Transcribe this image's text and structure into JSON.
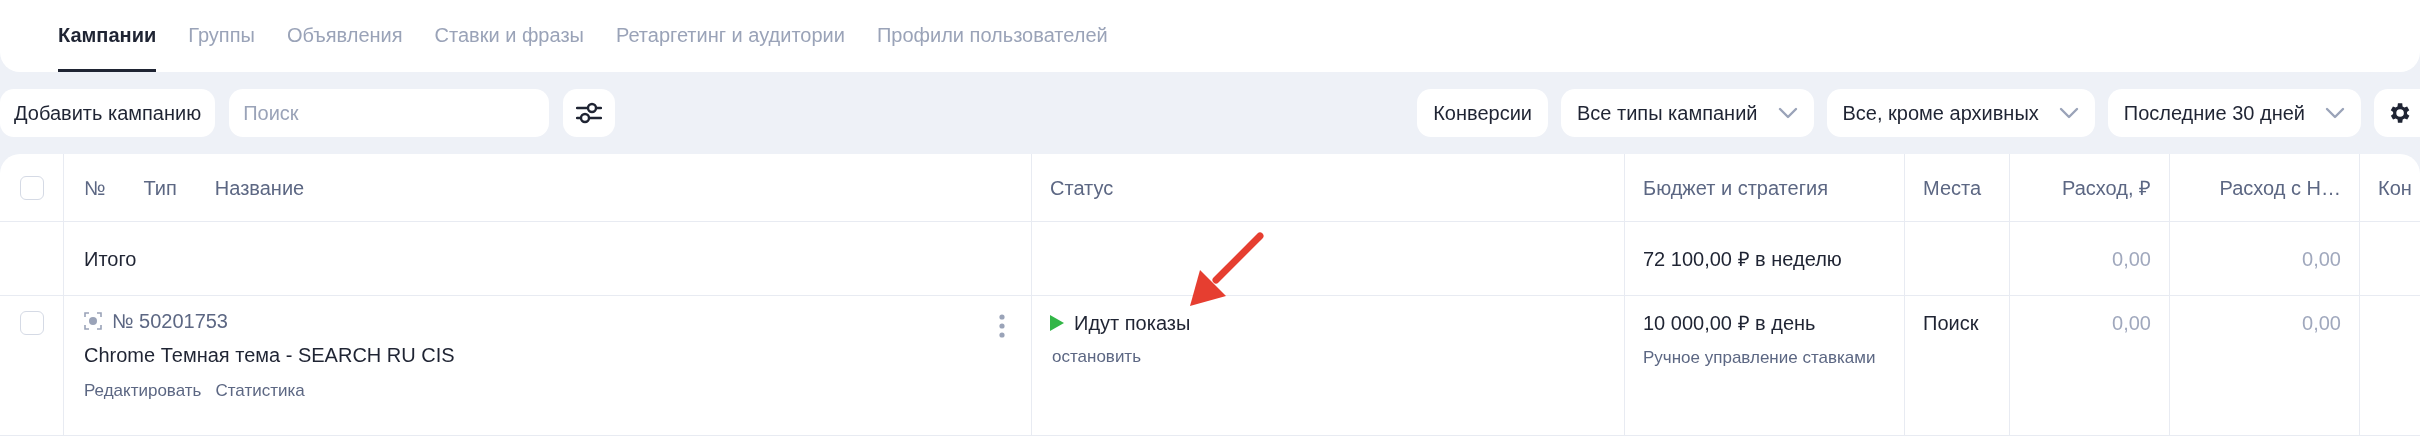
{
  "tabs": [
    {
      "label": "Кампании",
      "selected": true
    },
    {
      "label": "Группы",
      "selected": false
    },
    {
      "label": "Объявления",
      "selected": false
    },
    {
      "label": "Ставки и фразы",
      "selected": false
    },
    {
      "label": "Ретаргетинг и аудитории",
      "selected": false
    },
    {
      "label": "Профили пользователей",
      "selected": false
    }
  ],
  "toolbar": {
    "add_button": "Добавить кампанию",
    "search": {
      "placeholder": "Поиск"
    },
    "filters": [
      {
        "label": "Конверсии",
        "kind": "button"
      },
      {
        "label": "Все типы кампаний",
        "kind": "dropdown"
      },
      {
        "label": "Все, кроме архивных",
        "kind": "dropdown"
      },
      {
        "label": "Последние 30 дней",
        "kind": "dropdown"
      }
    ]
  },
  "table": {
    "header_checked": false,
    "name_columns": [
      "№",
      "Тип",
      "Название"
    ],
    "columns": [
      "Статус",
      "Бюджет и стратегия",
      "Места",
      "Расход, ₽",
      "Расход с Н…",
      "Кон"
    ],
    "total": {
      "label": "Итого",
      "budget": "72 100,00 ₽ в неделю",
      "spend": "0,00",
      "spend_vat": "0,00"
    },
    "rows": [
      {
        "checked": false,
        "number": "№ 50201753",
        "name": "Chrome Темная тема - SEARCH RU CIS",
        "actions": [
          "Редактировать",
          "Статистика"
        ],
        "status": {
          "running": true,
          "text": "Идут показы",
          "action": "остановить"
        },
        "budget": "10 000,00 ₽ в день",
        "strategy": "Ручное управление ставками",
        "places": "Поиск",
        "spend": "0,00",
        "spend_vat": "0,00"
      }
    ]
  }
}
